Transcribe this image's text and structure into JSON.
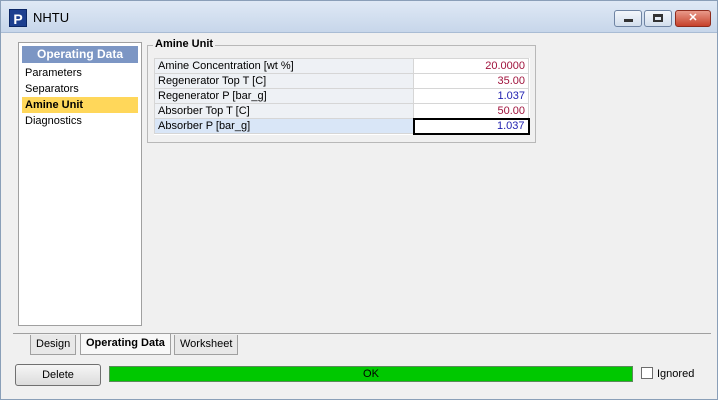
{
  "window": {
    "title": "NHTU",
    "app_icon_letter": "P"
  },
  "nav": {
    "header": "Operating Data",
    "items": [
      {
        "label": "Parameters",
        "active": false
      },
      {
        "label": "Separators",
        "active": false
      },
      {
        "label": "Amine Unit",
        "active": true
      },
      {
        "label": "Diagnostics",
        "active": false
      }
    ]
  },
  "group": {
    "title": "Amine Unit",
    "rows": [
      {
        "label": "Amine Concentration [wt %]",
        "value": "20.0000",
        "color": "#a0133c"
      },
      {
        "label": "Regenerator Top T [C]",
        "value": "35.00",
        "color": "#a0133c"
      },
      {
        "label": "Regenerator P [bar_g]",
        "value": "1.037",
        "color": "#1f1fb0"
      },
      {
        "label": "Absorber Top T [C]",
        "value": "50.00",
        "color": "#a0133c"
      },
      {
        "label": "Absorber P [bar_g]",
        "value": "1.037",
        "color": "#1f1fb0"
      }
    ]
  },
  "tabs": [
    {
      "label": "Design",
      "active": false
    },
    {
      "label": "Operating Data",
      "active": true
    },
    {
      "label": "Worksheet",
      "active": false
    }
  ],
  "footer": {
    "delete_label": "Delete",
    "status": "OK",
    "status_color": "#00c800",
    "ignored_label": "Ignored",
    "ignored_checked": false
  }
}
